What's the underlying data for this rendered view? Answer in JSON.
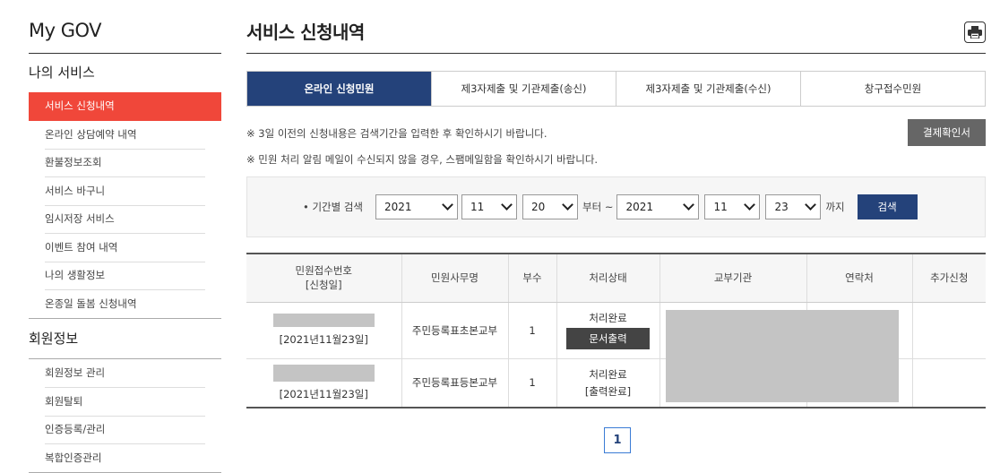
{
  "brand": "My GOV",
  "sidebar": {
    "section1_title": "나의 서비스",
    "items": [
      {
        "label": "서비스 신청내역"
      },
      {
        "label": "온라인 상담예약 내역"
      },
      {
        "label": "환불정보조회"
      },
      {
        "label": "서비스 바구니"
      },
      {
        "label": "임시저장 서비스"
      },
      {
        "label": "이벤트 참여 내역"
      },
      {
        "label": "나의 생활정보"
      },
      {
        "label": "온종일 돌봄 신청내역"
      }
    ],
    "section2_title": "회원정보",
    "items2": [
      {
        "label": "회원정보 관리"
      },
      {
        "label": "회원탈퇴"
      },
      {
        "label": "인증등록/관리"
      },
      {
        "label": "복합인증관리"
      }
    ]
  },
  "main": {
    "title": "서비스 신청내역",
    "tabs": [
      {
        "label": "온라인 신청민원"
      },
      {
        "label": "제3자제출 및 기관제출(송신)"
      },
      {
        "label": "제3자제출 및 기관제출(수신)"
      },
      {
        "label": "창구접수민원"
      }
    ],
    "note1": "※ 3일 이전의 신청내용은 검색기간을 입력한 후 확인하시기 바랍니다.",
    "note2": "※ 민원 처리 알림 메일이 수신되지 않을 경우, 스팸메일함을 확인하시기 바랍니다.",
    "pay_button": "결제확인서",
    "search": {
      "label": "• 기간별 검색",
      "from_year": "2021",
      "from_month": "11",
      "from_day": "20",
      "from_text": "부터 ~",
      "to_year": "2021",
      "to_month": "11",
      "to_day": "23",
      "to_text": "까지",
      "button": "검색"
    },
    "table": {
      "headers": {
        "receipt_line1": "민원접수번호",
        "receipt_line2": "[신청일]",
        "name": "민원사무명",
        "copies": "부수",
        "status": "처리상태",
        "agency": "교부기관",
        "contact": "연락처",
        "extra": "추가신청"
      },
      "rows": [
        {
          "date": "[2021년11월23일]",
          "name": "주민등록표초본교부",
          "copies": "1",
          "status": "처리완료",
          "action": "문서출력"
        },
        {
          "date": "[2021년11월23일]",
          "name": "주민등록표등본교부",
          "copies": "1",
          "status": "처리완료",
          "action": "[출력완료]"
        }
      ]
    },
    "pagination": {
      "current": "1"
    }
  },
  "colors": {
    "accent_red": "#f0473a",
    "navy": "#24427a",
    "redacted": "#c4c4c4"
  }
}
